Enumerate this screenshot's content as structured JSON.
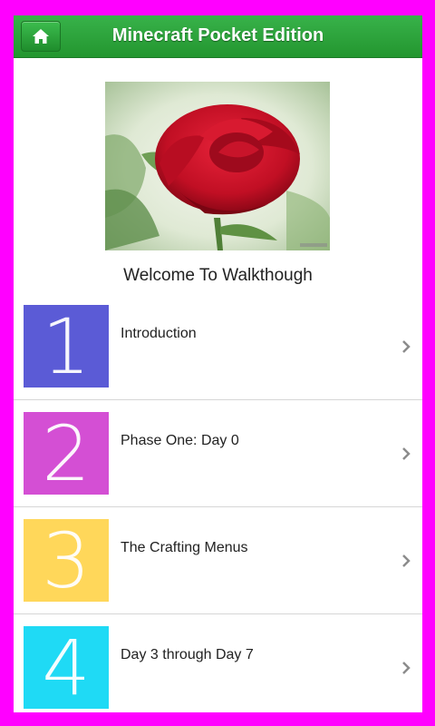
{
  "header": {
    "title": "Minecraft Pocket Edition",
    "home_icon": "home-icon",
    "bar_color": "#2ea63e"
  },
  "hero": {
    "image_description": "red-rose-photo"
  },
  "welcome_text": "Welcome To Walkthough",
  "items": [
    {
      "number": "1",
      "label": "Introduction",
      "color": "#5b5bd6"
    },
    {
      "number": "2",
      "label": "Phase One: Day 0",
      "color": "#d44fd4"
    },
    {
      "number": "3",
      "label": "The Crafting Menus",
      "color": "#ffd75a"
    },
    {
      "number": "4",
      "label": "Day 3 through Day 7",
      "color": "#1fdaf5"
    }
  ],
  "frame_color": "#ff00ff"
}
